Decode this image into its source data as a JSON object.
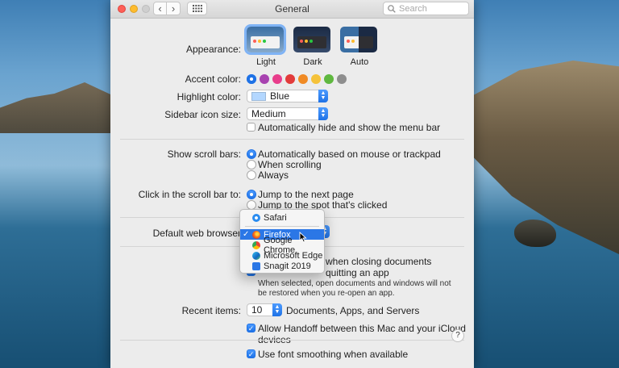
{
  "window": {
    "title": "General",
    "search_placeholder": "Search"
  },
  "appearance": {
    "label": "Appearance:",
    "options": [
      {
        "label": "Light",
        "selected": true
      },
      {
        "label": "Dark",
        "selected": false
      },
      {
        "label": "Auto",
        "selected": false
      }
    ]
  },
  "accent": {
    "label": "Accent color:",
    "colors": [
      "#1f72e6",
      "#a742b0",
      "#e83d8b",
      "#e23b3b",
      "#f08a24",
      "#f5c23a",
      "#5fb83f",
      "#8e8e8e"
    ]
  },
  "highlight": {
    "label": "Highlight color:",
    "value": "Blue",
    "swatch_color": "#b3d7ff"
  },
  "sidebar": {
    "label": "Sidebar icon size:",
    "value": "Medium"
  },
  "menubar": {
    "label": "Automatically hide and show the menu bar",
    "checked": false
  },
  "scrollbars": {
    "label": "Show scroll bars:",
    "options": [
      "Automatically based on mouse or trackpad",
      "When scrolling",
      "Always"
    ],
    "selected": 0
  },
  "click_scroll": {
    "label": "Click in the scroll bar to:",
    "options": [
      "Jump to the next page",
      "Jump to the spot that's clicked"
    ],
    "selected": 0
  },
  "browser": {
    "label": "Default web browser",
    "menu": [
      "Safari",
      "Firefox",
      "Google Chrome",
      "Microsoft Edge",
      "Snagit 2019"
    ],
    "selected": "Firefox"
  },
  "documents": {
    "ask_keep": "when closing documents",
    "close_windows": "quitting an app",
    "note": "When selected, open documents and windows will not be restored when you re-open an app."
  },
  "recent": {
    "label": "Recent items:",
    "value": "10",
    "suffix": "Documents, Apps, and Servers"
  },
  "handoff": {
    "label": "Allow Handoff between this Mac and your iCloud devices",
    "checked": true
  },
  "smoothing": {
    "label": "Use font smoothing when available",
    "checked": true
  },
  "help": {
    "label": "?"
  }
}
